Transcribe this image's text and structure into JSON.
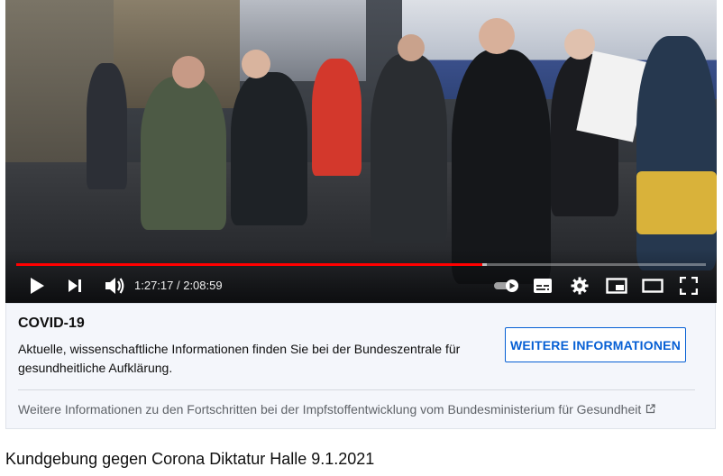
{
  "player": {
    "time_current": "1:27:17",
    "time_total": "2:08:59",
    "time_separator": " / ",
    "progress_fraction": 0.676,
    "buffer_fraction": 0.683,
    "accent_color": "#ff0000",
    "icons": [
      "play-icon",
      "next-icon",
      "volume-icon",
      "autoplay-toggle-icon",
      "subtitles-icon",
      "settings-gear-icon",
      "miniplayer-icon",
      "theater-mode-icon",
      "fullscreen-icon"
    ]
  },
  "info_panel": {
    "title": "COVID-19",
    "text": "Aktuelle, wissenschaftliche Informationen finden Sie bei der Bundeszentrale für gesundheitliche Aufklärung.",
    "button_label": "WEITERE INFORMATIONEN",
    "footer_link": "Weitere Informationen zu den Fortschritten bei der Impfstoffentwicklung vom Bundesministerium für Gesundheit",
    "link_color": "#065fd4"
  },
  "video": {
    "title": "Kundgebung gegen Corona Diktatur Halle 9.1.2021"
  }
}
